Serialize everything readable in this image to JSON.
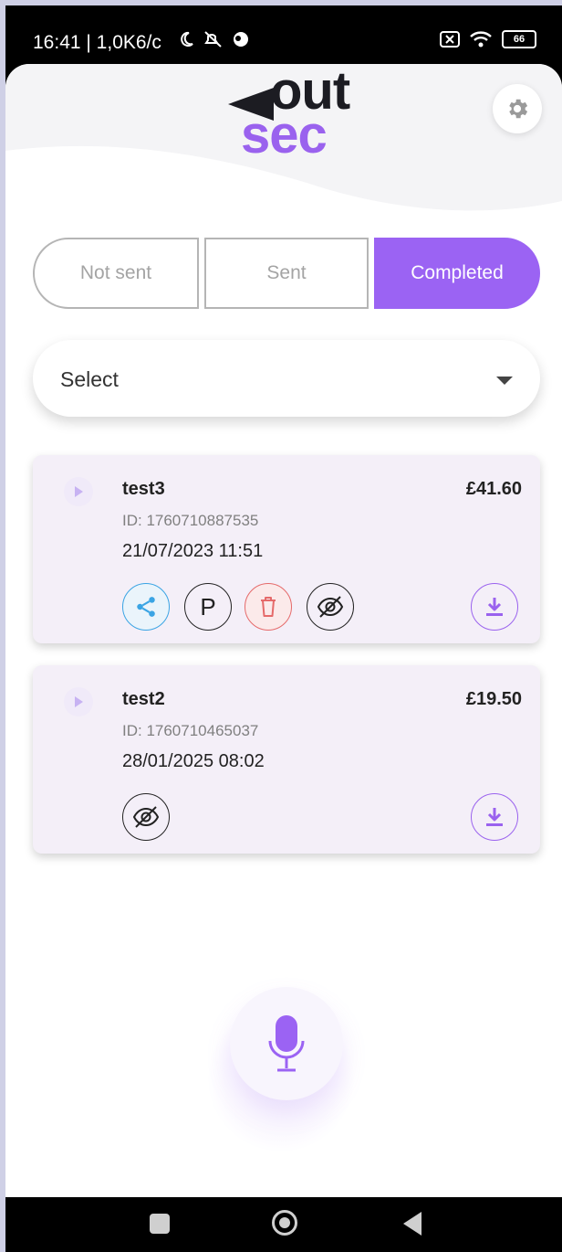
{
  "status_bar": {
    "time": "16:41 | 1,0K6/c",
    "battery": "66"
  },
  "app": {
    "logo_top": "out",
    "logo_bottom": "sec",
    "colors": {
      "accent": "#9b63f3",
      "share": "#3aa4e4",
      "delete": "#e56a6a"
    }
  },
  "tabs": [
    {
      "label": "Not sent",
      "active": false
    },
    {
      "label": "Sent",
      "active": false
    },
    {
      "label": "Completed",
      "active": true
    }
  ],
  "filter": {
    "selected": "Select"
  },
  "records": [
    {
      "name": "test3",
      "price": "£41.60",
      "id": "ID: 1760710887535",
      "date": "21/07/2023 11:51",
      "actions": [
        "share-icon",
        "p",
        "trash-icon",
        "eye-off-icon",
        "download-icon"
      ]
    },
    {
      "name": "test2",
      "price": "£19.50",
      "id": "ID: 1760710465037",
      "date": "28/01/2025 08:02",
      "actions": [
        "eye-off-icon",
        "download-icon"
      ]
    }
  ],
  "action_labels": {
    "p": "P"
  }
}
